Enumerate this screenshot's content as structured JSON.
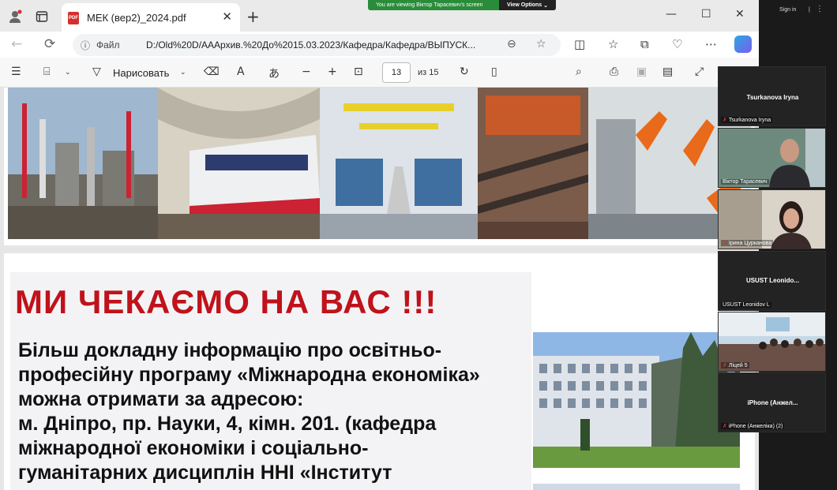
{
  "zoom_banner": {
    "message": "You are viewing Віктор Тарасевич's screen",
    "options_label": "View Options"
  },
  "browser": {
    "tab_title": "МЕК (вер2)_2024.pdf",
    "address_label": "Файл",
    "url": "D:/Old%20D/AAАрхив.%20До%2015.03.2023/Кафедра/Кафедра/ВЫПУСК..."
  },
  "pdf_toolbar": {
    "draw_label": "Нарисовать",
    "page_number": "13",
    "page_total": "из 15"
  },
  "document": {
    "headline": "МИ ЧЕКАЄМО НА ВАС !!!",
    "body_lines": [
      "Більш докладну інформацію про освітньо-",
      "професійну програму  «Міжнародна економіка»",
      "можна отримати за адресою:",
      "м. Дніпро, пр. Науки, 4,  кімн. 201. (кафедра",
      "міжнародної економіки і соціально-",
      "гуманітарних дисциплін ННІ «Інститут"
    ],
    "colors": {
      "headline": "#c0121a",
      "body": "#111111"
    }
  },
  "zoom": {
    "signin": "Sign in",
    "sep": "|",
    "participants": [
      {
        "display": "Tsurkanova Iryna",
        "label": "Tsurkanova Iryna",
        "muted": true,
        "video": false
      },
      {
        "display": "",
        "label": "Віктор Тарасевич",
        "muted": false,
        "video": true
      },
      {
        "display": "",
        "label": "Ірина Цурканова",
        "muted": true,
        "video": true
      },
      {
        "display": "USUST  Leonido...",
        "label": "USUST Leonidov L",
        "muted": false,
        "video": false
      },
      {
        "display": "",
        "label": "Ліцей 5",
        "muted": true,
        "video": true
      },
      {
        "display": "iPhone  (Анжел...",
        "label": "iPhone (Анжеліка) (2)",
        "muted": true,
        "video": false
      }
    ]
  }
}
